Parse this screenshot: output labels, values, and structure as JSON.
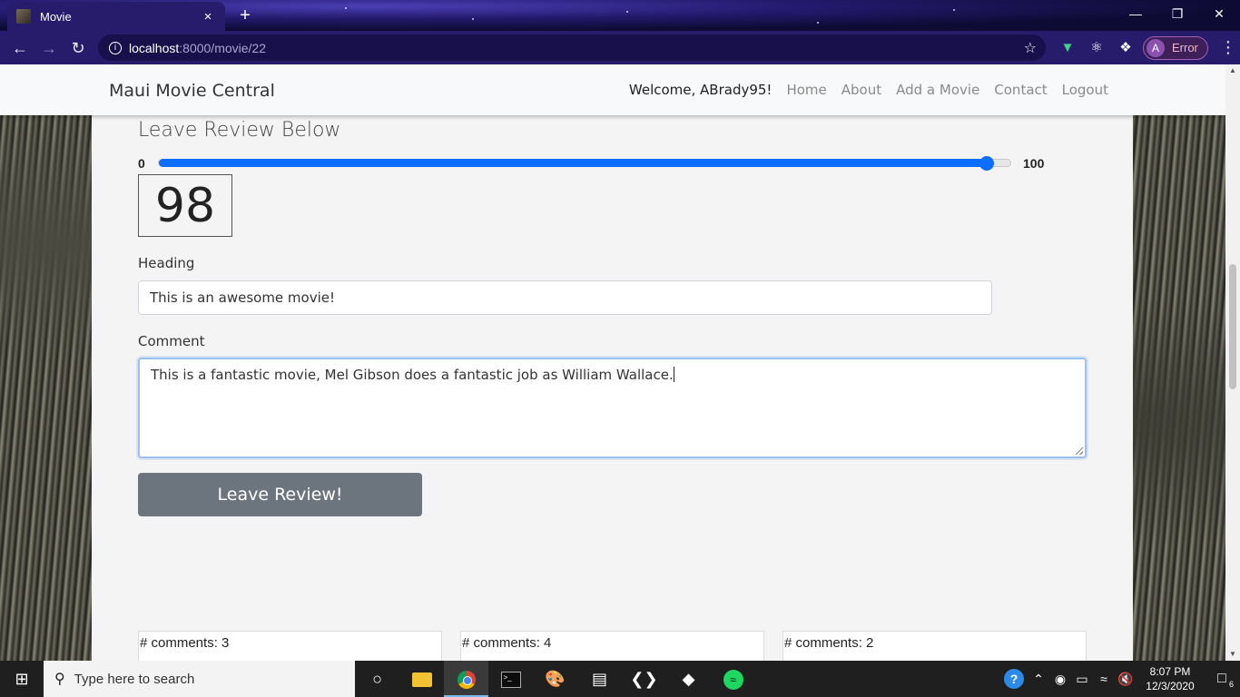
{
  "browser": {
    "tab_title": "Movie",
    "tab_close": "×",
    "new_tab": "+",
    "url_host": "localhost",
    "url_rest": ":8000/movie/22",
    "profile_initial": "A",
    "profile_status": "Error",
    "window": {
      "minimize": "—",
      "restore": "❐",
      "close": "✕"
    }
  },
  "navbar": {
    "brand": "Maui Movie Central",
    "welcome": "Welcome, ABrady95!",
    "links": [
      "Home",
      "About",
      "Add a Movie",
      "Contact",
      "Logout"
    ]
  },
  "review": {
    "title": "Leave Review Below",
    "range_min": "0",
    "range_max": "100",
    "score": "98",
    "heading_label": "Heading",
    "heading_value": "This is an awesome movie!",
    "comment_label": "Comment",
    "comment_value": "This is a fantastic movie, Mel Gibson does a fantastic job as William Wallace.",
    "submit_label": "Leave Review!"
  },
  "comment_cards": [
    "# comments: 3",
    "# comments: 4",
    "# comments: 2"
  ],
  "taskbar": {
    "search_placeholder": "Type here to search",
    "time": "8:07 PM",
    "date": "12/3/2020",
    "notification_count": "6"
  },
  "colors": {
    "slider_accent": "#0d6efd",
    "button_bg": "#6c757d",
    "focus_border": "#9ac1f2"
  },
  "icons": [
    "movie-favicon",
    "back-icon",
    "forward-icon",
    "reload-icon",
    "info-icon",
    "bookmark-star-icon",
    "vue-devtools-icon",
    "react-devtools-icon",
    "extensions-icon",
    "menu-icon",
    "windows-start-icon",
    "search-icon",
    "cortana-icon",
    "file-explorer-icon",
    "chrome-icon",
    "terminal-icon",
    "paint-icon",
    "notepad-icon",
    "vscode-icon",
    "git-icon",
    "spotify-icon"
  ]
}
